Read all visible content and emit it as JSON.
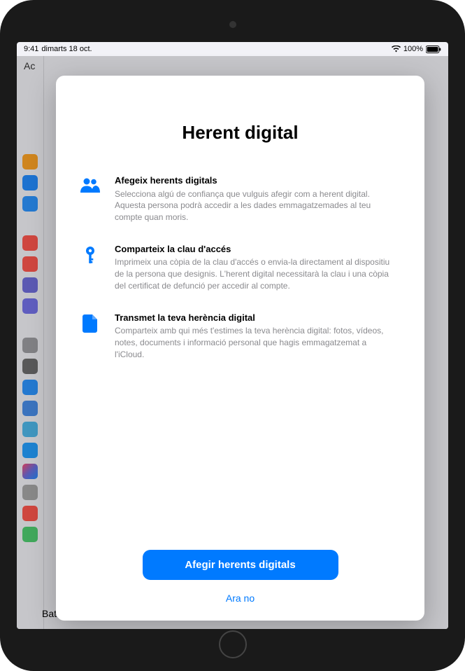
{
  "status": {
    "time": "9:41",
    "date": "dimarts 18 oct.",
    "battery": "100%"
  },
  "sidebar": {
    "partial_label_top": "Ac",
    "bottom_label": "Bateria"
  },
  "modal": {
    "title": "Herent digital",
    "items": [
      {
        "heading": "Afegeix herents digitals",
        "desc": "Selecciona algú de confiança que vulguis afegir com a herent digital. Aquesta persona podrà accedir a les dades emmagatzemades al teu compte quan moris."
      },
      {
        "heading": "Comparteix la clau d'accés",
        "desc": "Imprimeix una còpia de la clau d'accés o envia-la directament al dispositiu de la persona que designis. L'herent digital necessitarà la clau i una còpia del certificat de defunció per accedir al compte."
      },
      {
        "heading": "Transmet la teva herència digital",
        "desc": "Comparteix amb qui més t'estimes la teva herència digital: fotos, vídeos, notes, documents i informació personal que hagis emmagatzemat a l'iCloud."
      }
    ],
    "primary_button": "Afegir herents digitals",
    "secondary_button": "Ara no"
  },
  "colors": {
    "accent": "#007aff"
  }
}
